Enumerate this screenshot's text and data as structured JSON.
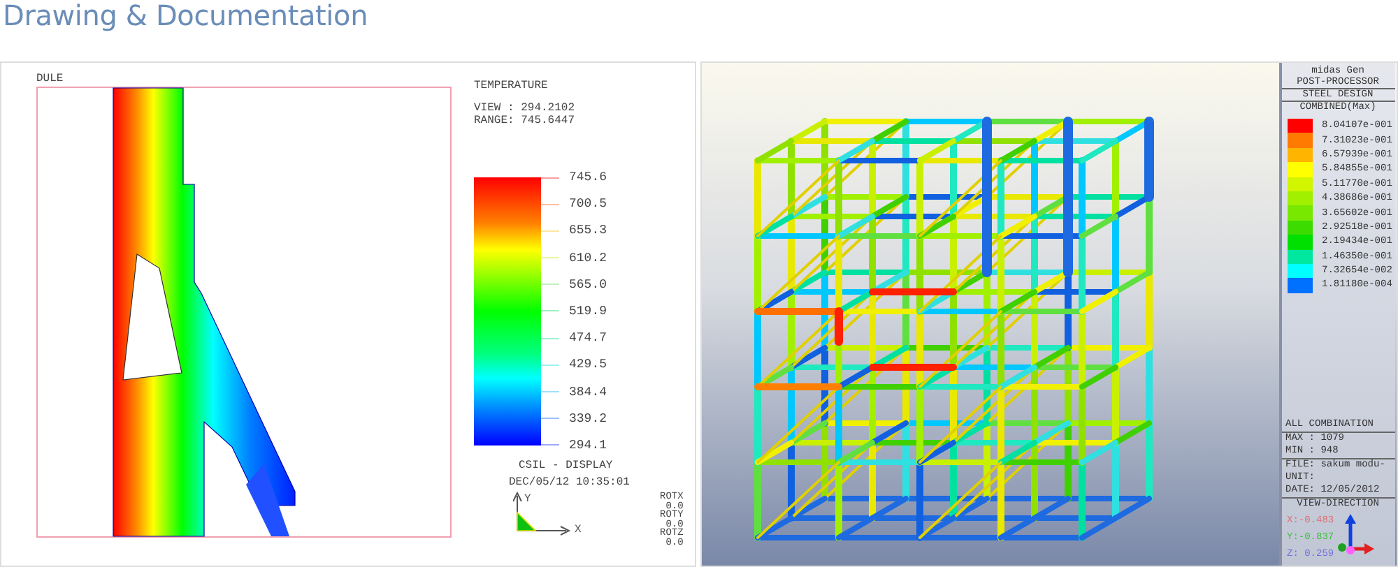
{
  "header": {
    "title": "Drawing & Documentation"
  },
  "thermal_view": {
    "model_label": "DULE",
    "result_title": "TEMPERATURE",
    "view_value": "VIEW : 294.2102",
    "range_value": "RANGE: 745.6447",
    "scale_labels": [
      "745.6",
      "700.5",
      "655.3",
      "610.2",
      "565.0",
      "519.9",
      "474.7",
      "429.5",
      "384.4",
      "339.2",
      "294.1"
    ],
    "display_label": "CSIL - DISPLAY",
    "timestamp": "DEC/05/12 10:35:01",
    "axis_labels": [
      "Y",
      "X"
    ],
    "rotations": [
      "ROTX",
      "0.0",
      "ROTY",
      "0.0",
      "ROTZ",
      "0.0"
    ]
  },
  "design_view": {
    "program": "midas Gen",
    "module": "POST-PROCESSOR",
    "analysis": "STEEL DESIGN",
    "result": "COMBINED(Max)",
    "legend": [
      {
        "label": "8.04107e-001",
        "color": "#ff0000"
      },
      {
        "label": "7.31023e-001",
        "color": "#ff7a00"
      },
      {
        "label": "6.57939e-001",
        "color": "#ffb400"
      },
      {
        "label": "5.84855e-001",
        "color": "#ffff00"
      },
      {
        "label": "5.11770e-001",
        "color": "#d2f500"
      },
      {
        "label": "4.38686e-001",
        "color": "#a0f000"
      },
      {
        "label": "3.65602e-001",
        "color": "#78e800"
      },
      {
        "label": "2.92518e-001",
        "color": "#3cdc00"
      },
      {
        "label": "2.19434e-001",
        "color": "#00e000"
      },
      {
        "label": "1.46350e-001",
        "color": "#00e8a0"
      },
      {
        "label": "7.32654e-002",
        "color": "#00ffff"
      },
      {
        "label": "1.81180e-004",
        "color": "#0070ff"
      }
    ],
    "combination": "ALL COMBINATION",
    "max": "MAX : 1079",
    "min": "MIN : 948",
    "file": "FILE: sakum modu-",
    "unit": "UNIT:",
    "date": "DATE: 12/05/2012",
    "view_direction_title": "VIEW-DIRECTION",
    "view_direction": [
      {
        "text": "X:-0.483",
        "color": "#e07070"
      },
      {
        "text": "Y:-0.837",
        "color": "#40c040"
      },
      {
        "text": "Z: 0.259",
        "color": "#7070e0"
      }
    ]
  }
}
